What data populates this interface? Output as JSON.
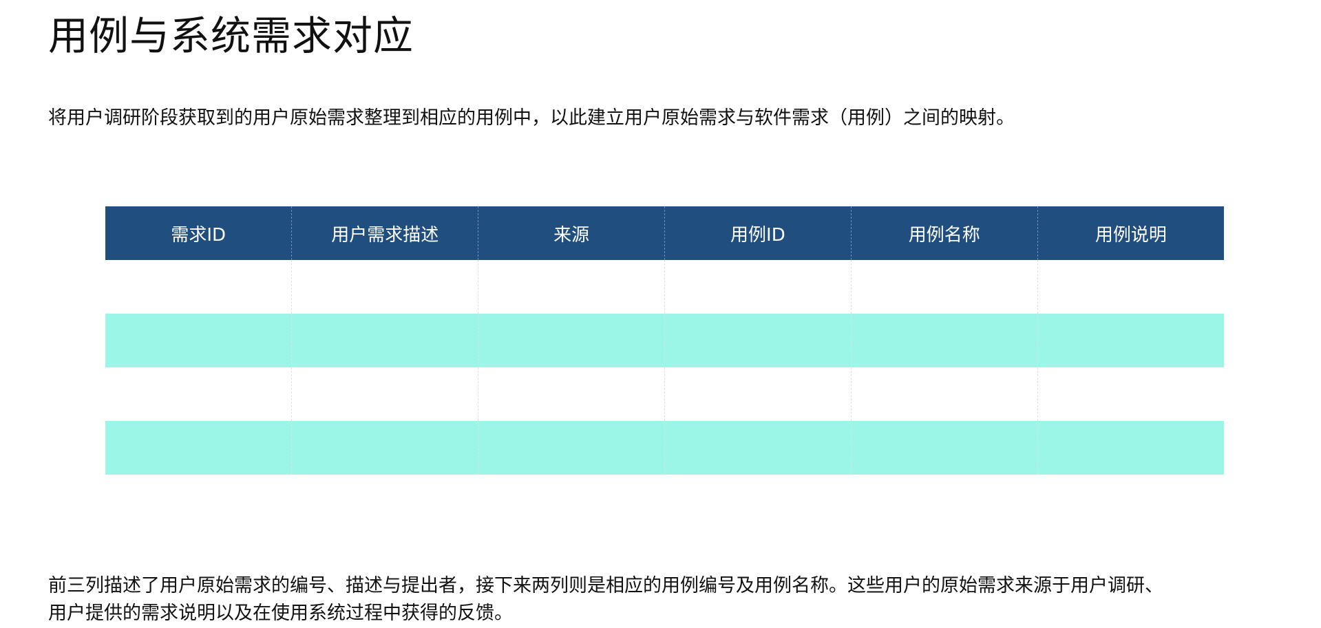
{
  "page": {
    "title": "用例与系统需求对应",
    "intro": "将用户调研阶段获取到的用户原始需求整理到相应的用例中，以此建立用户原始需求与软件需求（用例）之间的映射。",
    "outro_line1": "前三列描述了用户原始需求的编号、描述与提出者，接下来两列则是相应的用例编号及用例名称。这些用户的原始需求来源于用户调研、",
    "outro_line2": "用户提供的需求说明以及在使用系统过程中获得的反馈。"
  },
  "table": {
    "headers": [
      "需求ID",
      "用户需求描述",
      "来源",
      "用例ID",
      "用例名称",
      "用例说明"
    ],
    "rows": [
      [
        "",
        "",
        "",
        "",
        "",
        ""
      ],
      [
        "",
        "",
        "",
        "",
        "",
        ""
      ],
      [
        "",
        "",
        "",
        "",
        "",
        ""
      ],
      [
        "",
        "",
        "",
        "",
        "",
        ""
      ]
    ]
  },
  "colors": {
    "header_bg": "#204e7e",
    "header_text": "#ffffff",
    "stripe": "#9bf6e8",
    "row_plain": "#ffffff"
  }
}
